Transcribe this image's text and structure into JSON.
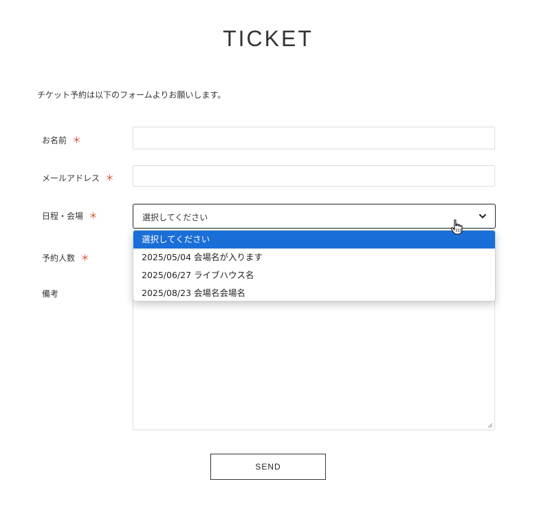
{
  "page": {
    "title": "TICKET",
    "intro": "チケット予約は以下のフォームよりお願いします。"
  },
  "form": {
    "required_mark": "＊",
    "name": {
      "label": "お名前",
      "value": ""
    },
    "email": {
      "label": "メールアドレス",
      "value": ""
    },
    "event": {
      "label": "日程・会場",
      "selected": "選択してください",
      "options": [
        "選択してください",
        "2025/05/04 会場名が入ります",
        "2025/06/27 ライブハウス名",
        "2025/08/23 会場名会場名"
      ]
    },
    "count": {
      "label": "予約人数"
    },
    "notes": {
      "label": "備考",
      "value": ""
    },
    "submit_label": "SEND"
  },
  "icons": {
    "chevron": "chevron-down-icon",
    "cursor": "hand-pointer-icon",
    "resize": "resize-handle-icon"
  },
  "colors": {
    "required": "#d9482b",
    "selected_option_bg": "#1a6ed8"
  }
}
